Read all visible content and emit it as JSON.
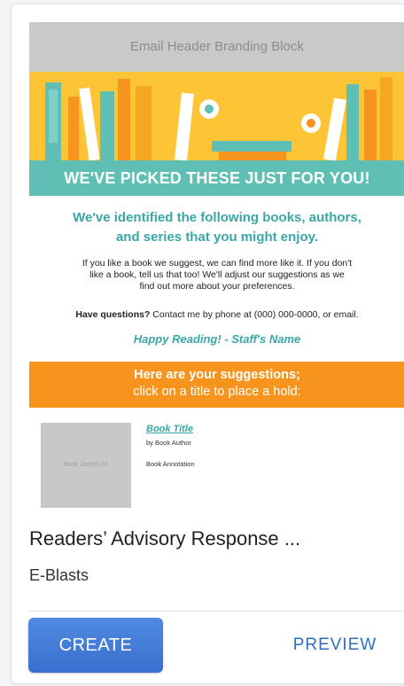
{
  "thumbnail": {
    "header_block": "Email Header Branding Block",
    "banner_heading": "WE'VE PICKED THESE JUST FOR YOU!",
    "intro_line1": "We've identified the following books, authors,",
    "intro_line2": "and series that you might enjoy.",
    "body_line1": "If you like a book we suggest, we can find more like it. If you don't",
    "body_line2": "like a book, tell us that too! We'll adjust our suggestions as we",
    "body_line3": "find out more about your preferences.",
    "questions_bold": "Have questions?",
    "questions_rest": " Contact me by phone at (000) 000-0000, or email.",
    "signoff": "Happy Reading! - Staff's Name",
    "suggestions_line1": "Here are your suggestions;",
    "suggestions_line2": "click on a title to place a hold:",
    "book_cover_text": "Book Jacket Url",
    "book_title": "Book Title",
    "book_author": "by Book Author",
    "book_annotation": "Book Annotation"
  },
  "card": {
    "title": "Readers’ Advisory Response ...",
    "category": "E-Blasts",
    "create_label": "CREATE",
    "preview_label": "PREVIEW"
  },
  "colors": {
    "teal": "#5fbfb4",
    "orange": "#f7941d",
    "yellow": "#fdc436",
    "create_blue": "#4178d6",
    "link_blue": "#2f6dbf"
  }
}
